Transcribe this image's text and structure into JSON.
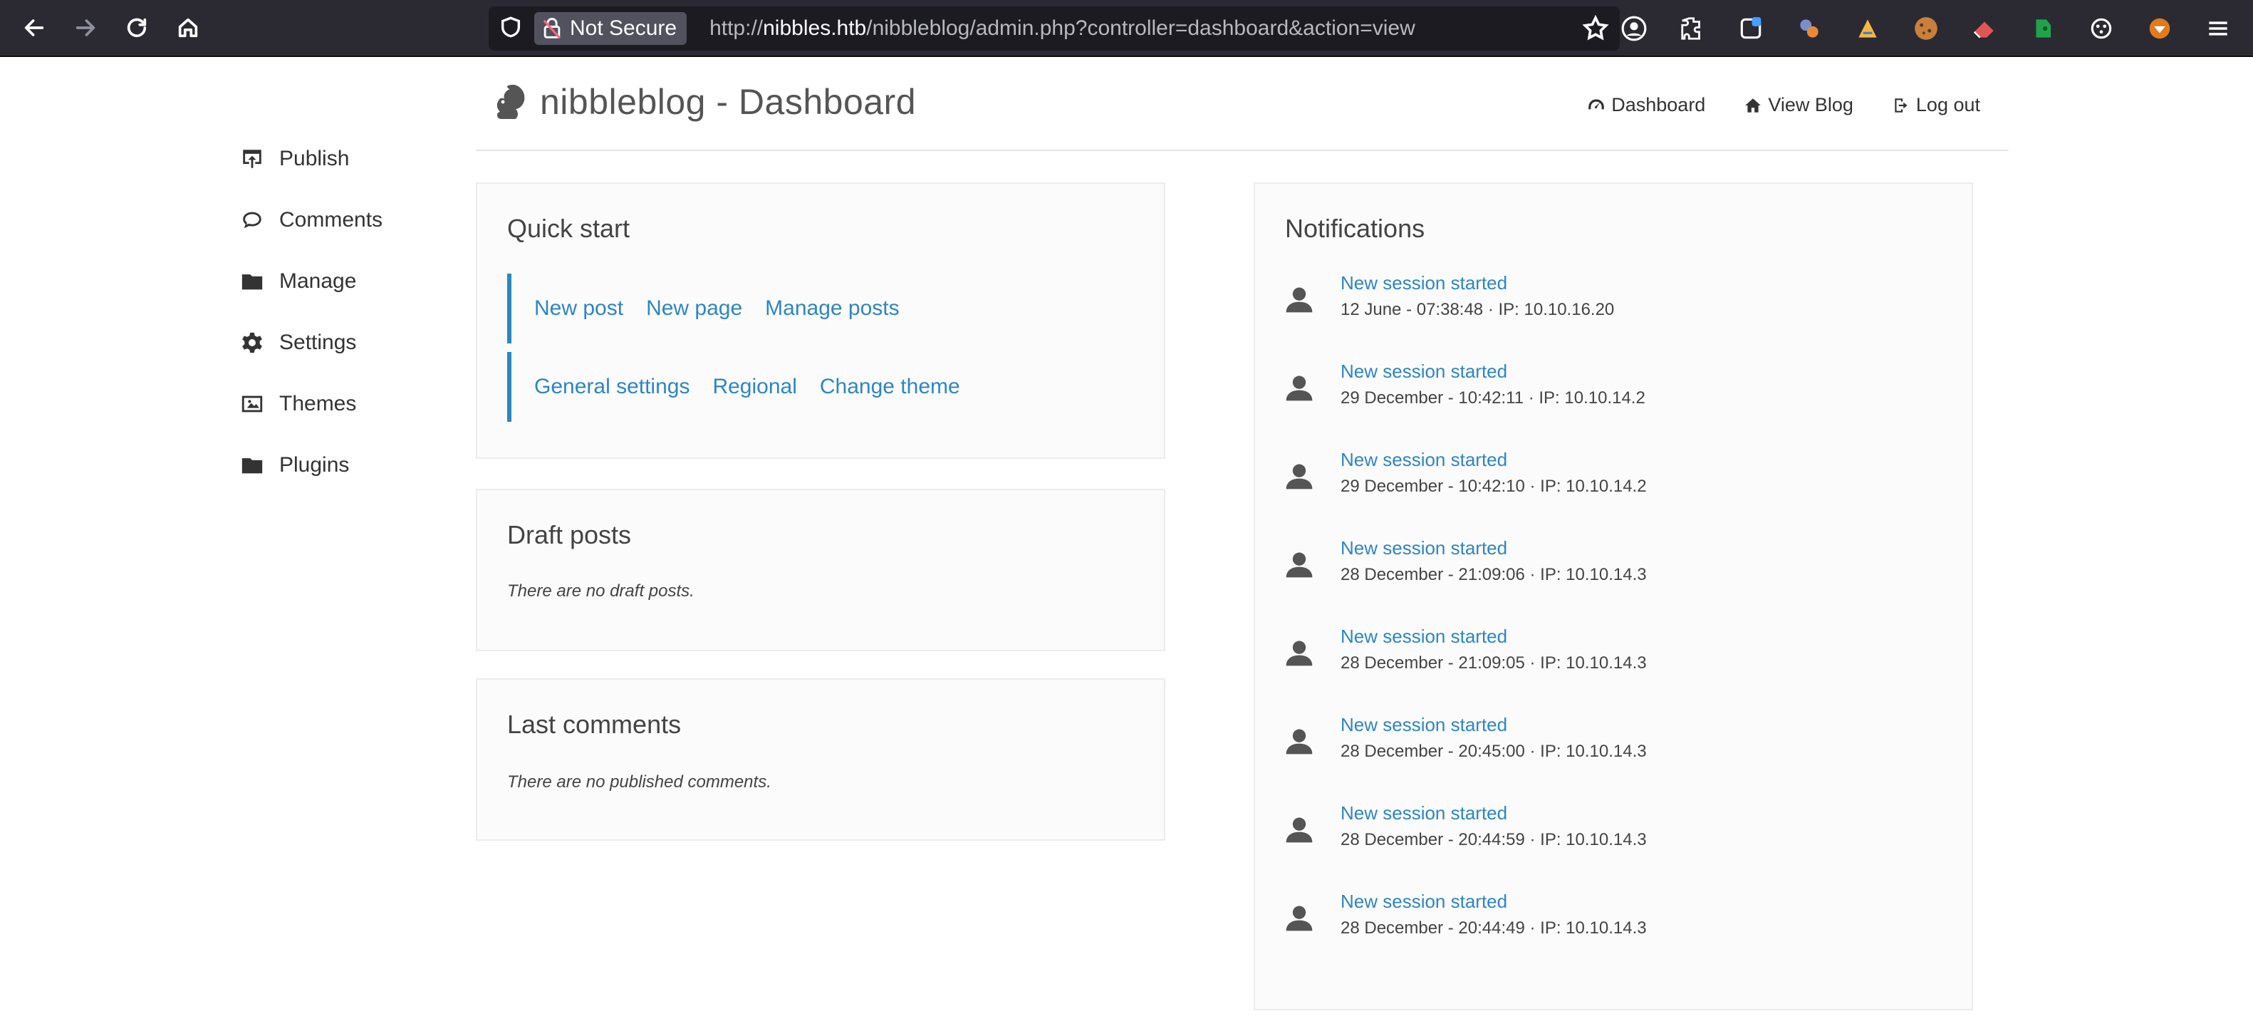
{
  "browser": {
    "security_label": "Not Secure",
    "url_scheme": "http://",
    "url_host": "nibbles.htb",
    "url_path": "/nibbleblog/admin.php?controller=dashboard&action=view",
    "icons": [
      "back-icon",
      "forward-icon",
      "reload-icon",
      "home-icon",
      "shield-icon",
      "lock-broken-icon",
      "star-icon",
      "account-icon",
      "extensions-icon",
      "container-icon",
      "extension-icon",
      "extension-icon",
      "cookie-icon",
      "eraser-icon",
      "evernote-icon",
      "settings-icon",
      "fox-icon",
      "menu-icon"
    ]
  },
  "sidebar": {
    "items": [
      {
        "label": "Publish",
        "icon": "publish-icon"
      },
      {
        "label": "Comments",
        "icon": "comment-icon"
      },
      {
        "label": "Manage",
        "icon": "folder-icon"
      },
      {
        "label": "Settings",
        "icon": "gear-icon"
      },
      {
        "label": "Themes",
        "icon": "image-icon"
      },
      {
        "label": "Plugins",
        "icon": "folder-icon"
      }
    ]
  },
  "header": {
    "title": "nibbleblog - Dashboard",
    "nav": [
      {
        "label": "Dashboard",
        "icon": "dashboard-icon"
      },
      {
        "label": "View Blog",
        "icon": "home-icon"
      },
      {
        "label": "Log out",
        "icon": "logout-icon"
      }
    ]
  },
  "quick_start": {
    "title": "Quick start",
    "row1": [
      "New post",
      "New page",
      "Manage posts"
    ],
    "row2": [
      "General settings",
      "Regional",
      "Change theme"
    ]
  },
  "draft_posts": {
    "title": "Draft posts",
    "empty": "There are no draft posts."
  },
  "last_comments": {
    "title": "Last comments",
    "empty": "There are no published comments."
  },
  "notifications": {
    "title": "Notifications",
    "items": [
      {
        "title": "New session started",
        "detail": "12 June - 07:38:48 · IP: 10.10.16.20"
      },
      {
        "title": "New session started",
        "detail": "29 December - 10:42:11 · IP: 10.10.14.2"
      },
      {
        "title": "New session started",
        "detail": "29 December - 10:42:10 · IP: 10.10.14.2"
      },
      {
        "title": "New session started",
        "detail": "28 December - 21:09:06 · IP: 10.10.14.3"
      },
      {
        "title": "New session started",
        "detail": "28 December - 21:09:05 · IP: 10.10.14.3"
      },
      {
        "title": "New session started",
        "detail": "28 December - 20:45:00 · IP: 10.10.14.3"
      },
      {
        "title": "New session started",
        "detail": "28 December - 20:44:59 · IP: 10.10.14.3"
      },
      {
        "title": "New session started",
        "detail": "28 December - 20:44:49 · IP: 10.10.14.3"
      }
    ]
  },
  "colors": {
    "link": "#2e86c1",
    "accent_bar": "#2a88c0",
    "chrome_bg": "#2b2a33"
  }
}
